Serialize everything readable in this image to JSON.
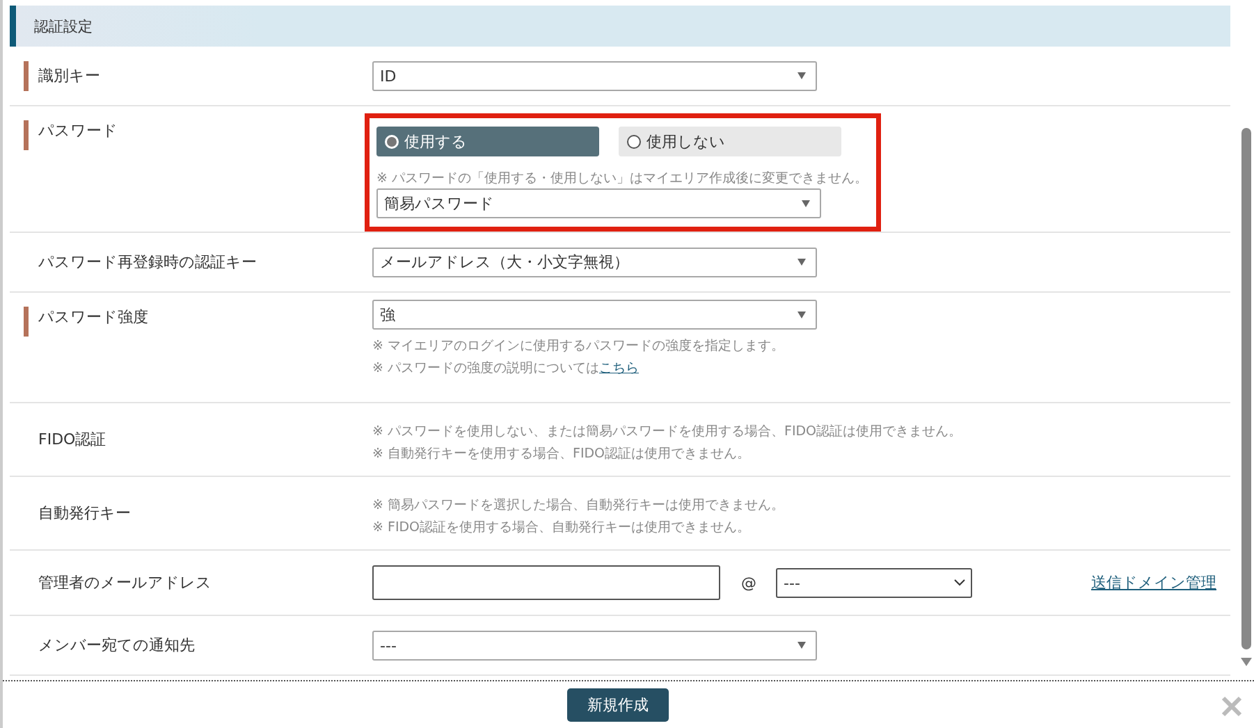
{
  "section_title": "認証設定",
  "rows": [
    {
      "kind": "select",
      "label": "識別キー",
      "required": true,
      "value": "ID",
      "notes": []
    },
    {
      "kind": "password",
      "label": "パスワード",
      "required": true,
      "highlighted": true,
      "radios": [
        {
          "label": "使用する",
          "selected": true
        },
        {
          "label": "使用しない",
          "selected": false
        }
      ],
      "notes": [
        {
          "text": "※ パスワードの「使用する・使用しない」はマイエリア作成後に変更できません。"
        }
      ],
      "value": "簡易パスワード"
    },
    {
      "kind": "select",
      "label": "パスワード再登録時の認証キー",
      "required": false,
      "value": "メールアドレス（大・小文字無視）",
      "notes": []
    },
    {
      "kind": "select",
      "label": "パスワード強度",
      "required": true,
      "value": "強",
      "notes": [
        {
          "text": "※ マイエリアのログインに使用するパスワードの強度を指定します。"
        },
        {
          "text": "※ パスワードの強度の説明については",
          "link": "こちら"
        }
      ]
    },
    {
      "kind": "notes",
      "label": "FIDO認証",
      "required": false,
      "notes": [
        {
          "text": "※ パスワードを使用しない、または簡易パスワードを使用する場合、FIDO認証は使用できません。"
        },
        {
          "text": "※ 自動発行キーを使用する場合、FIDO認証は使用できません。"
        }
      ]
    },
    {
      "kind": "notes",
      "label": "自動発行キー",
      "required": false,
      "notes": [
        {
          "text": "※ 簡易パスワードを選択した場合、自動発行キーは使用できません。"
        },
        {
          "text": "※ FIDO認証を使用する場合、自動発行キーは使用できません。"
        }
      ]
    },
    {
      "kind": "email",
      "label": "管理者のメールアドレス",
      "required": false,
      "at": "@",
      "domain": "---",
      "link": "送信ドメイン管理",
      "notes": []
    },
    {
      "kind": "select",
      "label": "メンバー宛ての通知先",
      "required": false,
      "value": "---",
      "notes": []
    }
  ],
  "submit": "新規作成"
}
